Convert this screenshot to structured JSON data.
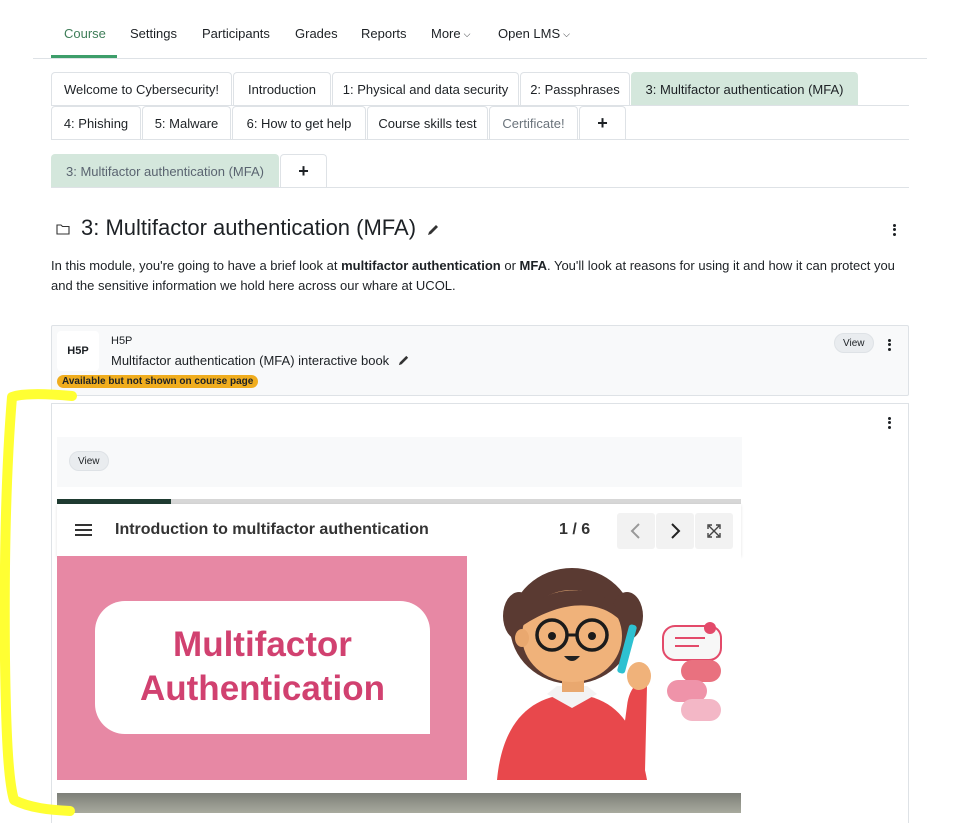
{
  "topnav": {
    "items": [
      {
        "label": "Course",
        "active": true
      },
      {
        "label": "Settings"
      },
      {
        "label": "Participants"
      },
      {
        "label": "Grades"
      },
      {
        "label": "Reports"
      },
      {
        "label": "More"
      },
      {
        "label": "Open LMS"
      }
    ]
  },
  "tabs": {
    "row1": [
      "Welcome to Cybersecurity!",
      "Introduction",
      "1: Physical and data security",
      "2: Passphrases",
      "3: Multifactor authentication (MFA)"
    ],
    "row2": [
      "4: Phishing",
      "5: Malware",
      "6: How to get help",
      "Course skills test",
      "Certificate!",
      "+"
    ],
    "sub": [
      "3: Multifactor authentication (MFA)",
      "+"
    ]
  },
  "section": {
    "title": "3: Multifactor authentication (MFA)",
    "summary_parts": [
      "In this module, you're going to have a brief look at ",
      "multifactor authentication",
      " or ",
      "MFA",
      ". You'll look at reasons for using it and how it can protect you and the sensitive information we hold here across our whare at UCOL."
    ]
  },
  "activity": {
    "icon_text": "H5P",
    "type": "H5P",
    "name": "Multifactor authentication (MFA) interactive book",
    "badge": "Available but not shown on course page",
    "view_label": "View"
  },
  "embed": {
    "view_label": "View",
    "book_title": "Introduction to multifactor authentication",
    "page_indicator": "1 / 6",
    "progress": 0.167,
    "slide_text_line1": "Multifactor",
    "slide_text_line2": "Authentication"
  },
  "colors": {
    "accent_green": "#3d9e6a",
    "active_tab_bg": "#d4e7dc",
    "badge": "#f0ad1e",
    "slide_pink": "#e788a4",
    "slide_text": "#d14170",
    "highlight": "#ffff33"
  }
}
